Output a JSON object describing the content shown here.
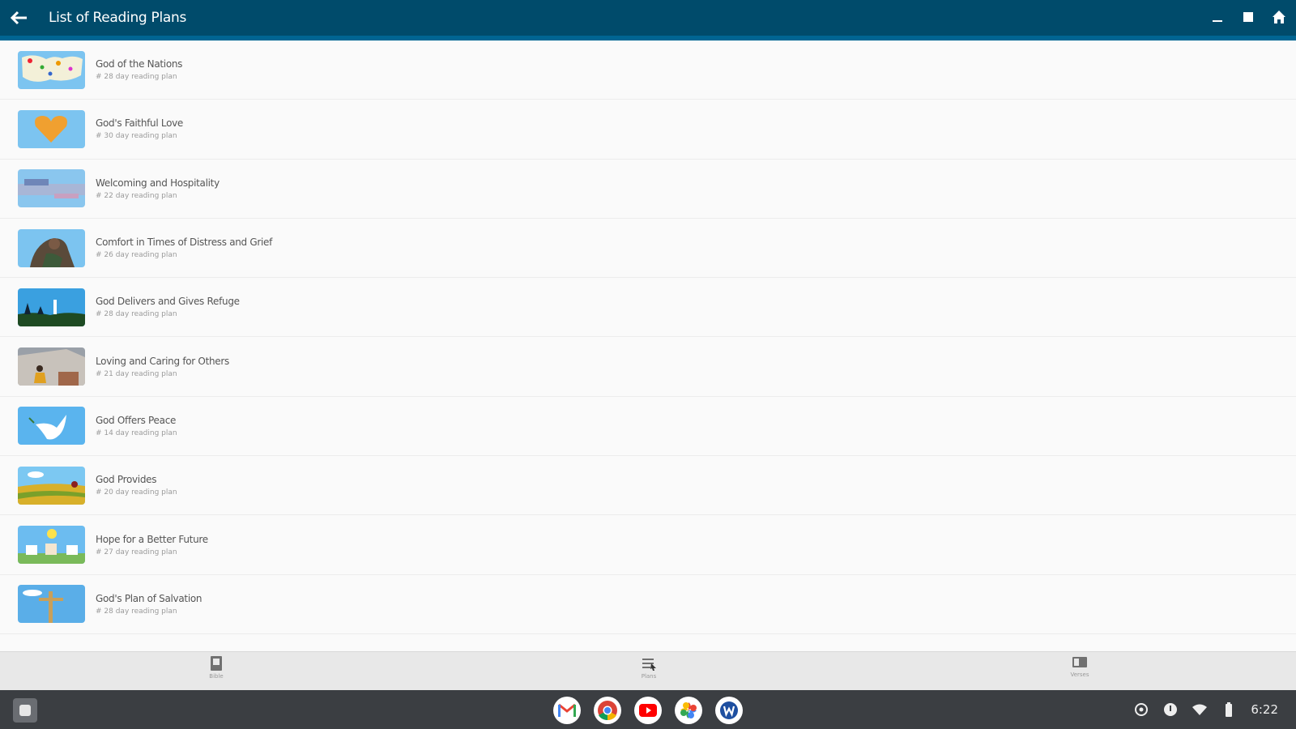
{
  "window": {
    "title": "List of Reading Plans",
    "colors": {
      "titlebar": "#004b6b",
      "titlebar_accent": "#006592"
    }
  },
  "plans": [
    {
      "title": "God of the Nations",
      "subtitle": "# 28 day reading plan"
    },
    {
      "title": "God's Faithful Love",
      "subtitle": "# 30 day reading plan"
    },
    {
      "title": "Welcoming and Hospitality",
      "subtitle": "# 22 day reading plan"
    },
    {
      "title": "Comfort in Times of Distress and Grief",
      "subtitle": "# 26 day reading plan"
    },
    {
      "title": "God Delivers and Gives Refuge",
      "subtitle": "# 28 day reading plan"
    },
    {
      "title": "Loving and Caring for Others",
      "subtitle": "# 21 day reading plan"
    },
    {
      "title": "God Offers Peace",
      "subtitle": "# 14 day reading plan"
    },
    {
      "title": "God Provides",
      "subtitle": "# 20 day reading plan"
    },
    {
      "title": "Hope for a Better Future",
      "subtitle": "# 27 day reading plan"
    },
    {
      "title": "God's Plan of Salvation",
      "subtitle": "# 28 day reading plan"
    }
  ],
  "bottom_nav": {
    "items": [
      {
        "label": "Bible",
        "icon": "book-icon"
      },
      {
        "label": "Plans",
        "icon": "plans-icon"
      },
      {
        "label": "Verses",
        "icon": "verses-icon"
      }
    ]
  },
  "shelf": {
    "apps": [
      "gmail-icon",
      "chrome-icon",
      "youtube-icon",
      "photos-icon",
      "word-app-icon"
    ],
    "time": "6:22"
  }
}
